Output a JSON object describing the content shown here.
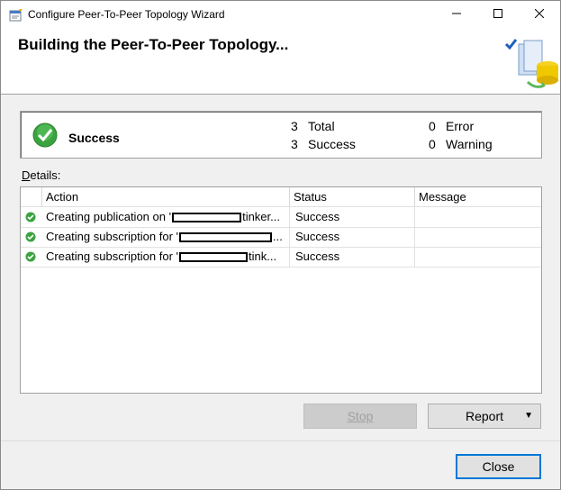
{
  "window": {
    "title": "Configure Peer-To-Peer Topology Wizard",
    "min_label": "—",
    "max_label": "☐",
    "close_label": "✕"
  },
  "header": {
    "title": "Building the Peer-To-Peer Topology..."
  },
  "summary": {
    "status": "Success",
    "total_count": "3",
    "total_label": "Total",
    "success_count": "3",
    "success_label": "Success",
    "error_count": "0",
    "error_label": "Error",
    "warning_count": "0",
    "warning_label": "Warning"
  },
  "details": {
    "label_accel": "D",
    "label_rest": "etails:"
  },
  "grid": {
    "columns": [
      "Action",
      "Status",
      "Message"
    ],
    "rows": [
      {
        "action_pre": "Creating publication on '",
        "action_post": "tinker...",
        "status": "Success",
        "message": ""
      },
      {
        "action_pre": "Creating subscription for '",
        "action_post": "...",
        "status": "Success",
        "message": ""
      },
      {
        "action_pre": "Creating subscription for '",
        "action_post": "tink...",
        "status": "Success",
        "message": ""
      }
    ]
  },
  "buttons": {
    "stop": "Stop",
    "report": "Report",
    "report_caret": "▼",
    "close": "Close"
  },
  "colors": {
    "success_green": "#2e9e3a",
    "accent_blue": "#0078d7"
  }
}
